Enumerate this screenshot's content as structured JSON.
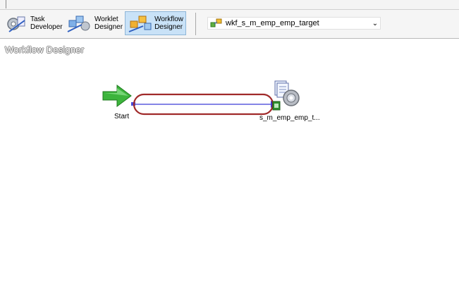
{
  "toolbar": {
    "task_developer": {
      "line1": "Task",
      "line2": "Developer"
    },
    "worklet_designer": {
      "line1": "Worklet",
      "line2": "Designer"
    },
    "workflow_designer": {
      "line1": "Workflow",
      "line2": "Designer"
    },
    "workflow_select_value": "wkf_s_m_emp_emp_target"
  },
  "canvas": {
    "title": "Workflow Designer",
    "start_label": "Start",
    "session_label": "s_m_emp_emp_t..."
  },
  "colors": {
    "active_tool_bg": "#c9e2f7",
    "link_color": "#3a3ad8",
    "highlight_ellipse": "#a02a2a",
    "start_arrow": "#3cb43c"
  },
  "icons": {
    "task_developer": "task-developer-icon",
    "worklet_designer": "worklet-designer-icon",
    "workflow_designer": "workflow-designer-icon",
    "workflow": "workflow-icon",
    "start": "start-arrow-icon",
    "session": "session-gear-icon"
  }
}
